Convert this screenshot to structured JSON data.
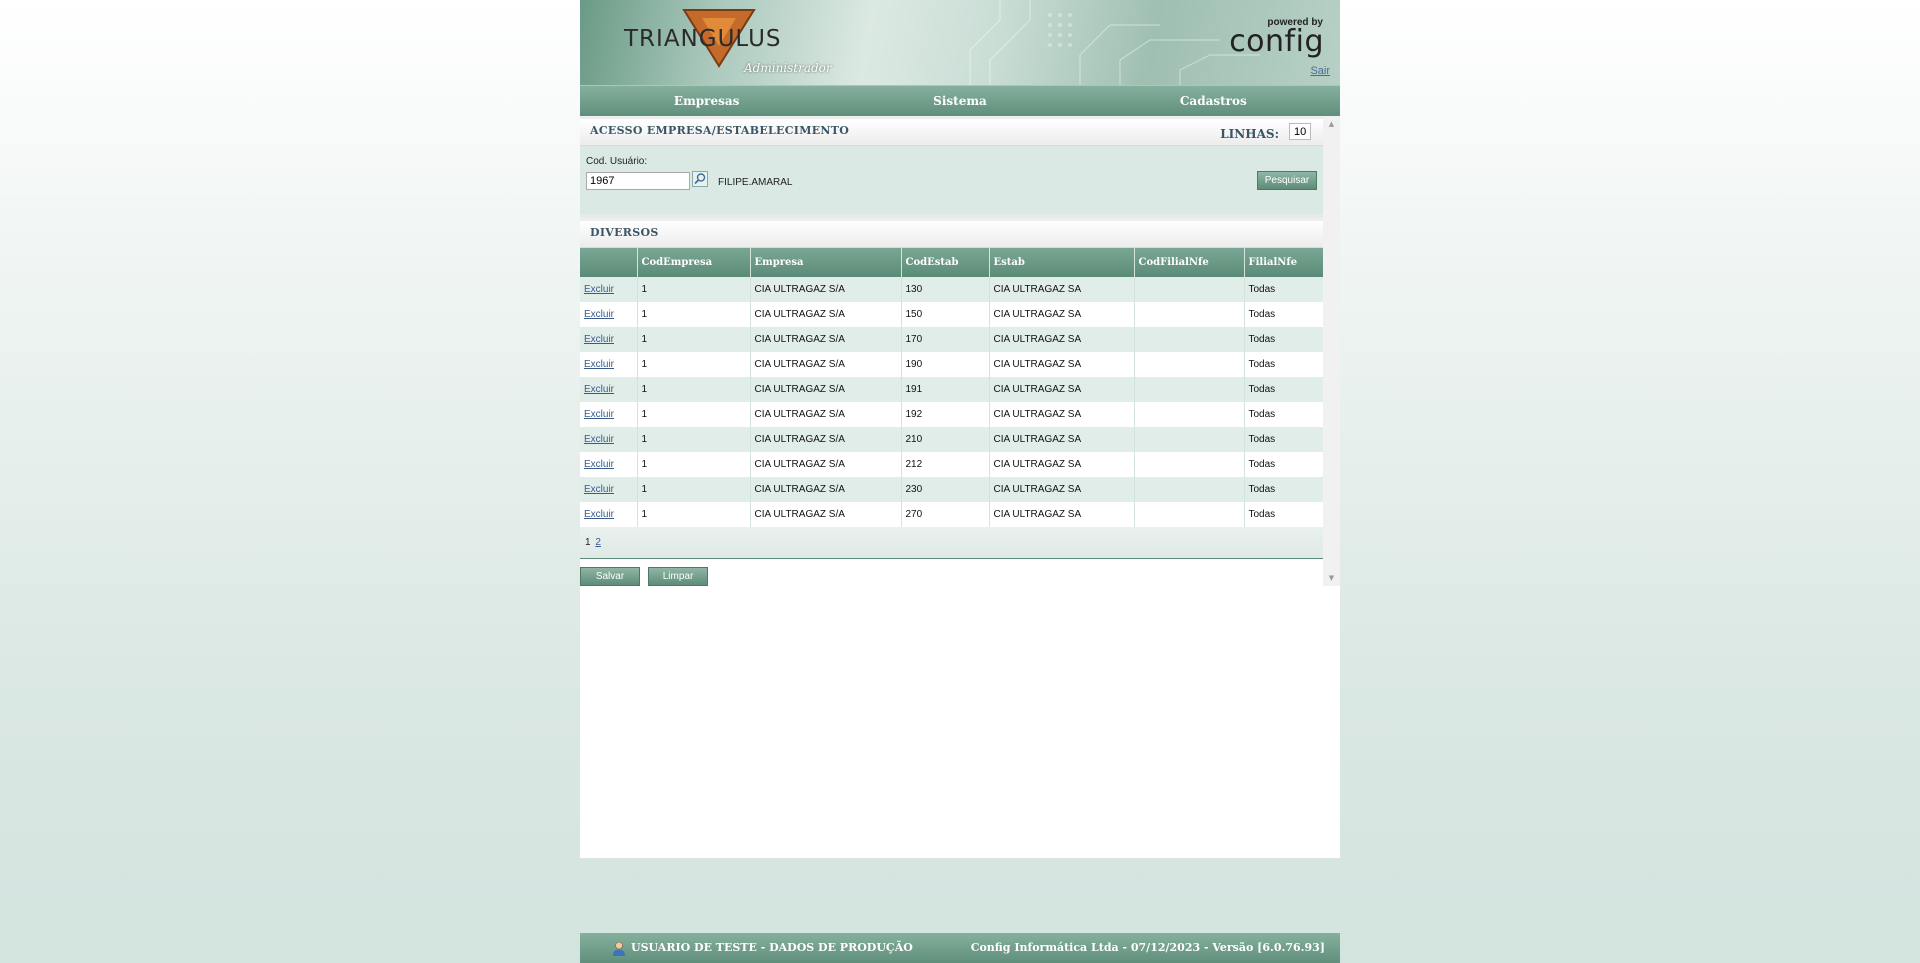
{
  "header": {
    "logo_text": "TRIANGULUS",
    "logo_sub": "Administrador",
    "powered_by": "powered by",
    "brand": "config",
    "logout": "Sair"
  },
  "nav": {
    "items": [
      {
        "label": "Empresas"
      },
      {
        "label": "Sistema"
      },
      {
        "label": "Cadastros"
      }
    ]
  },
  "access_section": {
    "title": "ACESSO EMPRESA/ESTABELECIMENTO",
    "linhas_label": "LINHAS:",
    "linhas_value": "10",
    "user_code_label": "Cod. Usuário:",
    "user_code_value": "1967",
    "user_name": "FILIPE.AMARAL",
    "search_button": "Pesquisar"
  },
  "diversos_section": {
    "title": "DIVERSOS"
  },
  "table": {
    "columns": [
      "",
      "CodEmpresa",
      "Empresa",
      "CodEstab",
      "Estab",
      "CodFilialNfe",
      "FilialNfe"
    ],
    "action_label": "Excluir",
    "rows": [
      {
        "cod_empresa": "1",
        "empresa": "CIA ULTRAGAZ S/A",
        "cod_estab": "130",
        "estab": "CIA ULTRAGAZ SA",
        "cod_filial_nfe": "",
        "filial_nfe": "Todas"
      },
      {
        "cod_empresa": "1",
        "empresa": "CIA ULTRAGAZ S/A",
        "cod_estab": "150",
        "estab": "CIA ULTRAGAZ SA",
        "cod_filial_nfe": "",
        "filial_nfe": "Todas"
      },
      {
        "cod_empresa": "1",
        "empresa": "CIA ULTRAGAZ S/A",
        "cod_estab": "170",
        "estab": "CIA ULTRAGAZ SA",
        "cod_filial_nfe": "",
        "filial_nfe": "Todas"
      },
      {
        "cod_empresa": "1",
        "empresa": "CIA ULTRAGAZ S/A",
        "cod_estab": "190",
        "estab": "CIA ULTRAGAZ SA",
        "cod_filial_nfe": "",
        "filial_nfe": "Todas"
      },
      {
        "cod_empresa": "1",
        "empresa": "CIA ULTRAGAZ S/A",
        "cod_estab": "191",
        "estab": "CIA ULTRAGAZ SA",
        "cod_filial_nfe": "",
        "filial_nfe": "Todas"
      },
      {
        "cod_empresa": "1",
        "empresa": "CIA ULTRAGAZ S/A",
        "cod_estab": "192",
        "estab": "CIA ULTRAGAZ SA",
        "cod_filial_nfe": "",
        "filial_nfe": "Todas"
      },
      {
        "cod_empresa": "1",
        "empresa": "CIA ULTRAGAZ S/A",
        "cod_estab": "210",
        "estab": "CIA ULTRAGAZ SA",
        "cod_filial_nfe": "",
        "filial_nfe": "Todas"
      },
      {
        "cod_empresa": "1",
        "empresa": "CIA ULTRAGAZ S/A",
        "cod_estab": "212",
        "estab": "CIA ULTRAGAZ SA",
        "cod_filial_nfe": "",
        "filial_nfe": "Todas"
      },
      {
        "cod_empresa": "1",
        "empresa": "CIA ULTRAGAZ S/A",
        "cod_estab": "230",
        "estab": "CIA ULTRAGAZ SA",
        "cod_filial_nfe": "",
        "filial_nfe": "Todas"
      },
      {
        "cod_empresa": "1",
        "empresa": "CIA ULTRAGAZ S/A",
        "cod_estab": "270",
        "estab": "CIA ULTRAGAZ SA",
        "cod_filial_nfe": "",
        "filial_nfe": "Todas"
      }
    ]
  },
  "pager": {
    "current": "1",
    "pages": [
      "2"
    ]
  },
  "actions": {
    "save": "Salvar",
    "clear": "Limpar"
  },
  "footer": {
    "user_status": "USUARIO DE TESTE - DADOS DE PRODUÇÃO",
    "company_version": "Config Informática Ltda - 07/12/2023 - Versão [6.0.76.93]"
  },
  "icons": {
    "lookup": "magnifier-icon",
    "user": "user-icon",
    "scroll_up": "chevron-up-icon",
    "scroll_down": "chevron-down-icon"
  },
  "colors": {
    "theme_green": "#5f8f7b",
    "row_alt": "#e1ede8",
    "link": "#3a5b8c"
  }
}
